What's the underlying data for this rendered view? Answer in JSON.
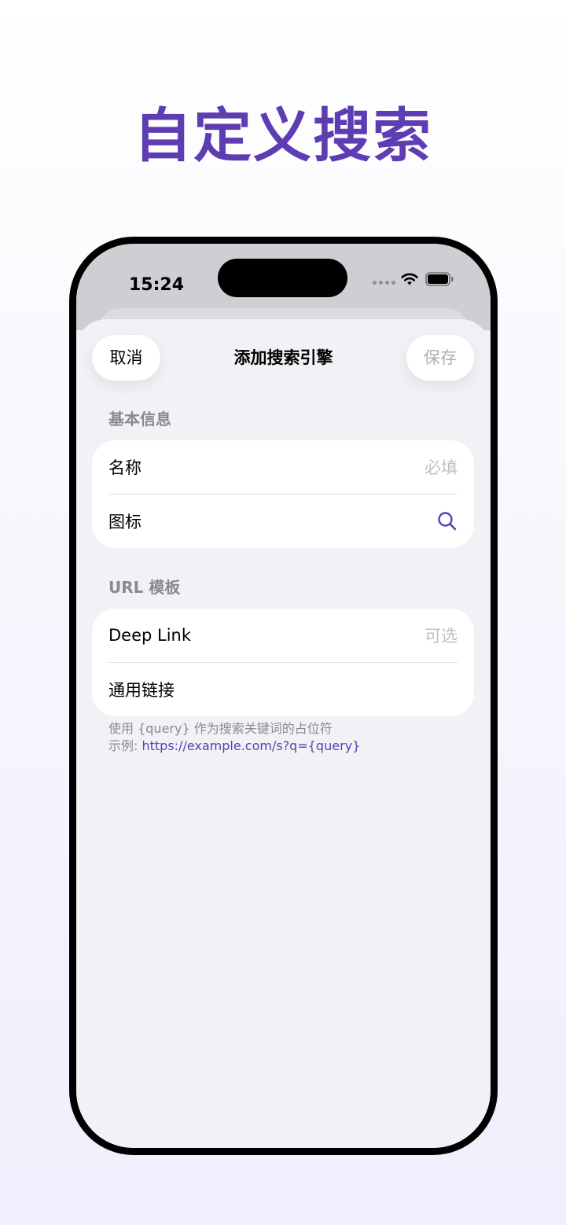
{
  "headline": "自定义搜索",
  "status_bar": {
    "time": "15:24"
  },
  "sheet": {
    "title": "添加搜索引擎",
    "cancel_label": "取消",
    "save_label": "保存"
  },
  "sections": [
    {
      "header": "基本信息",
      "rows": [
        {
          "label": "名称",
          "placeholder": "必填"
        },
        {
          "label": "图标",
          "icon": "search-icon"
        }
      ]
    },
    {
      "header": "URL 模板",
      "rows": [
        {
          "label": "Deep Link",
          "placeholder": "可选"
        },
        {
          "label": "通用链接",
          "placeholder": ""
        }
      ]
    }
  ],
  "footer": {
    "line1": "使用 {query} 作为搜索关键词的占位符",
    "line2_prefix": "示例: ",
    "line2_link": "https://example.com/s?q={query}"
  },
  "colors": {
    "accent": "#5e3db3",
    "placeholder": "#c0c0c4",
    "section_header": "#8a8a8e",
    "background": "#f2f1f6"
  }
}
